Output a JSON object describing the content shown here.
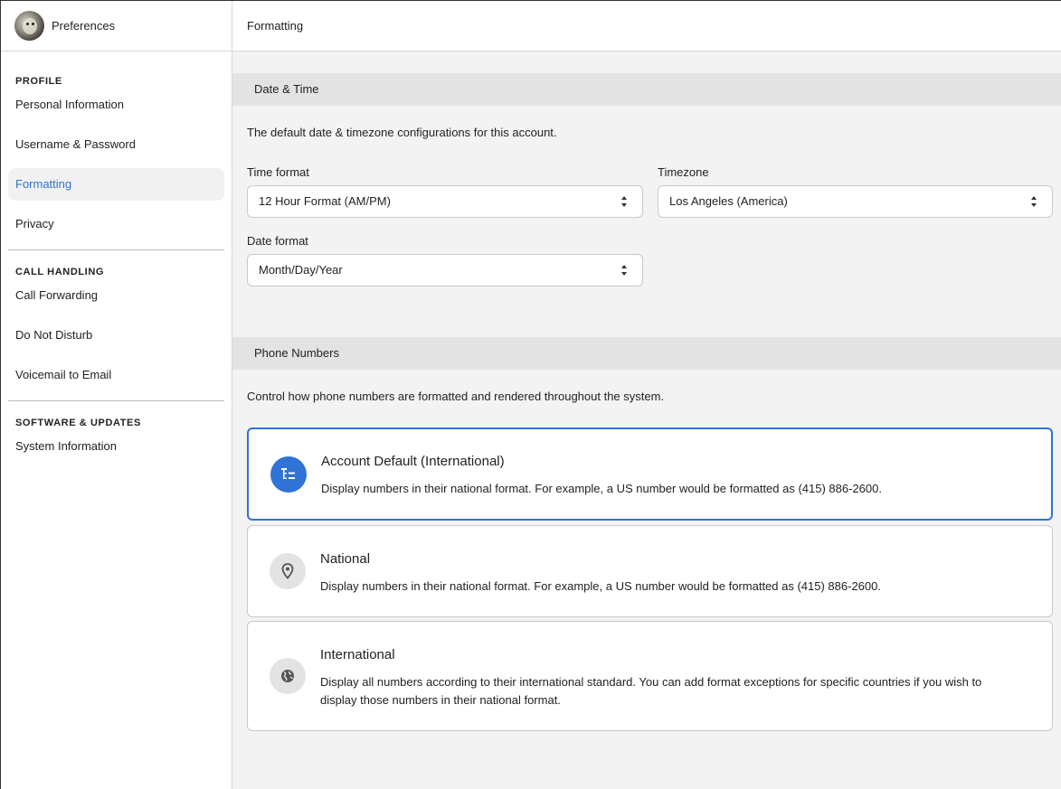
{
  "sidebar": {
    "title": "Preferences",
    "sections": [
      {
        "heading": "PROFILE",
        "items": [
          "Personal Information",
          "Username & Password",
          "Formatting",
          "Privacy"
        ]
      },
      {
        "heading": "CALL HANDLING",
        "items": [
          "Call Forwarding",
          "Do Not Disturb",
          "Voicemail to Email"
        ]
      },
      {
        "heading": "SOFTWARE & UPDATES",
        "items": [
          "System Information"
        ]
      }
    ],
    "active_item": "Formatting"
  },
  "header": {
    "title": "Formatting"
  },
  "date_time": {
    "heading": "Date & Time",
    "description": "The default date & timezone configurations for this account.",
    "time_format": {
      "label": "Time format",
      "value": "12 Hour Format (AM/PM)"
    },
    "timezone": {
      "label": "Timezone",
      "value": "Los Angeles (America)"
    },
    "date_format": {
      "label": "Date format",
      "value": "Month/Day/Year"
    }
  },
  "phone_numbers": {
    "heading": "Phone Numbers",
    "description": "Control how phone numbers are formatted and rendered throughout the system.",
    "options": [
      {
        "title": "Account Default (International)",
        "description": "Display numbers in their national format. For example, a US number would be formatted as (415) 886-2600.",
        "icon": "list-tree-icon",
        "selected": true
      },
      {
        "title": "National",
        "description": "Display numbers in their national format. For example, a US number would be formatted as (415) 886-2600.",
        "icon": "map-pin-icon",
        "selected": false
      },
      {
        "title": "International",
        "description": "Display all numbers according to their international standard. You can add format exceptions for specific countries if you wish to display those numbers in their national format.",
        "icon": "globe-icon",
        "selected": false
      }
    ]
  },
  "colors": {
    "accent": "#2f73d6",
    "active_bg": "#f1f1f1",
    "section_bg": "#e3e3e3",
    "page_bg": "#f3f3f3"
  }
}
